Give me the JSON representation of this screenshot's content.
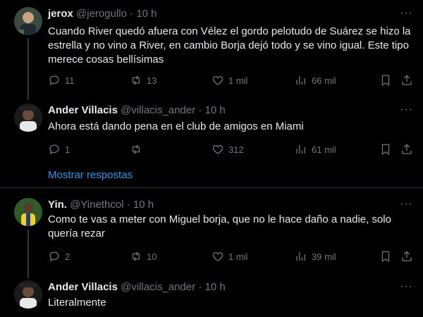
{
  "tweets": [
    {
      "name": "jerox",
      "handle": "@jerogullo",
      "dot": "·",
      "time": "10 h",
      "text": "Cuando River quedó afuera con Vélez el gordo pelotudo de Suárez se hizo la estrella y no vino a River, en cambio Borja dejó todo y se vino igual. Este tipo merece cosas bellísimas",
      "replies": "11",
      "retweets": "13",
      "likes": "1 mil",
      "views": "66 mil"
    },
    {
      "name": "Ander Villacis",
      "handle": "@villacis_ander",
      "dot": "·",
      "time": "10 h",
      "text": "Ahora está dando pena en el club de amigos en Miami",
      "replies": "1",
      "retweets": "",
      "likes": "312",
      "views": "61 mil"
    },
    {
      "name": "Yin.",
      "handle": "@Yinethcol",
      "dot": "·",
      "time": "10 h",
      "text": "Como te vas a meter con Miguel borja, que no le hace daño a nadie, solo quería rezar",
      "replies": "2",
      "retweets": "10",
      "likes": "1 mil",
      "views": "39 mil"
    },
    {
      "name": "Ander Villacis",
      "handle": "@villacis_ander",
      "dot": "·",
      "time": "10 h",
      "text": "Literalmente"
    }
  ],
  "show_replies": "Mostrar respostas",
  "icons": {
    "reply": "reply-icon",
    "retweet": "retweet-icon",
    "like": "heart-icon",
    "views": "views-icon",
    "bookmark": "bookmark-icon",
    "share": "share-icon",
    "more": "more-icon"
  },
  "colors": {
    "background": "#000000",
    "text": "#e7e9ea",
    "muted": "#71767b",
    "link": "#1d9bf0",
    "divider": "#2f3336"
  }
}
